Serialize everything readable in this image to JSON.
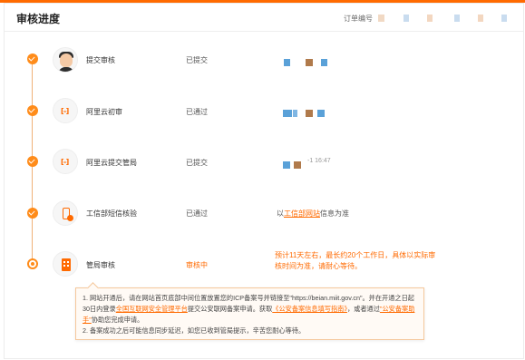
{
  "header": {
    "title": "审核进度",
    "order_label": "订单编号"
  },
  "colors": {
    "accent": "#ff6a00",
    "done_dot": "#ff8c1a",
    "timeline": "#f0b178",
    "redaction_blue": "#5aa1d8",
    "redaction_brown": "#b07a4b"
  },
  "steps": [
    {
      "name": "提交审核",
      "status": "已提交",
      "icon": "user-avatar-icon",
      "state": "done"
    },
    {
      "name": "阿里云初审",
      "status": "已通过",
      "icon": "aliyun-logo-icon",
      "state": "done"
    },
    {
      "name": "阿里云提交管局",
      "status": "已提交",
      "icon": "aliyun-logo-icon",
      "state": "done",
      "time_fragment": "-1 16:47"
    },
    {
      "name": "工信部短信核验",
      "status": "已通过",
      "icon": "phone-verify-icon",
      "state": "done",
      "note_prefix": "以",
      "note_link": "工信部网站",
      "note_suffix": "信息为准"
    },
    {
      "name": "管局审核",
      "status": "审核中",
      "icon": "government-building-icon",
      "state": "current",
      "eta": "预计11天左右，最长约20个工作日，具体以实际审核时间为准，请耐心等待。"
    }
  ],
  "tip": {
    "line1_a": "1. 网站开通后，请在网站首页底部中间位置放置您的ICP备案号并链接至\"https://beian.miit.gov.cn\"。并在开通之日起30日内登录",
    "line1_link1": "全国互联网安全管理平台",
    "line1_b": "提交公安联网备案申请。获取",
    "line1_link2": "《公安备案信息填写指南》",
    "line1_c": "，或者通过",
    "line1_link3": "\"公安备案助手\"",
    "line1_d": "协助您完成申请。",
    "line2": "2. 备案成功之后可能信息同步延迟，如您已收到管局提示，辛苦您耐心等待。"
  }
}
